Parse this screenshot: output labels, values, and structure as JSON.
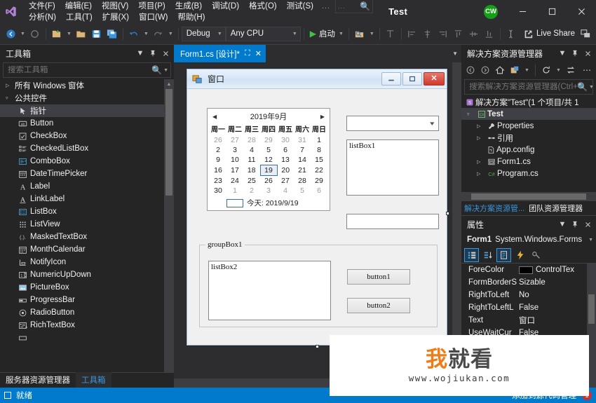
{
  "titlebar": {
    "logo_icon": "visual-studio-logo",
    "menus_row1": [
      "文件(F)",
      "编辑(E)",
      "视图(V)",
      "项目(P)",
      "生成(B)",
      "调试(D)",
      "格式(O)",
      "测试(S)"
    ],
    "menus_row2": [
      "分析(N)",
      "工具(T)",
      "扩展(X)",
      "窗口(W)",
      "帮助(H)"
    ],
    "menu_overflow": "...",
    "search_dots": "...",
    "app_title": "Test",
    "avatar_initials": "CW",
    "avatar_color": "#16a016",
    "minimize_icon": "minimize-icon",
    "maximize_icon": "maximize-icon",
    "close_icon": "close-icon"
  },
  "toolbar": {
    "back_icon": "navigate-back-icon",
    "forward_icon": "navigate-forward-icon",
    "new_project_icon": "new-project-icon",
    "open_icon": "open-file-icon",
    "save_icon": "save-icon",
    "save_all_icon": "save-all-icon",
    "undo_icon": "undo-icon",
    "redo_icon": "redo-icon",
    "config_value": "Debug",
    "platform_value": "Any CPU",
    "start_label": "启动",
    "start_icon": "play-icon",
    "find_icon": "find-in-files-icon",
    "align_icons": [
      "align-to-grid-icon",
      "align-lefts-icon",
      "align-centers-icon",
      "align-rights-icon",
      "align-tops-icon",
      "align-middles-icon",
      "align-bottoms-icon",
      "spacing-icon"
    ],
    "live_share_label": "Live Share",
    "live_share_icon": "live-share-icon",
    "feedback_icon": "feedback-icon"
  },
  "toolbox": {
    "title": "工具箱",
    "dropdown_icon": "chevron-down-icon",
    "pin_icon": "pin-icon",
    "close_icon": "close-icon",
    "search_placeholder": "搜索工具箱",
    "search_icon": "search-icon",
    "groups": [
      {
        "label": "所有 Windows 窗体",
        "expanded": false
      },
      {
        "label": "公共控件",
        "expanded": true
      }
    ],
    "items": [
      {
        "label": "指针",
        "icon": "pointer-icon",
        "selected": true
      },
      {
        "label": "Button",
        "icon": "button-icon"
      },
      {
        "label": "CheckBox",
        "icon": "checkbox-icon"
      },
      {
        "label": "CheckedListBox",
        "icon": "checked-listbox-icon"
      },
      {
        "label": "ComboBox",
        "icon": "combobox-icon"
      },
      {
        "label": "DateTimePicker",
        "icon": "datetimepicker-icon"
      },
      {
        "label": "Label",
        "icon": "label-icon"
      },
      {
        "label": "LinkLabel",
        "icon": "linklabel-icon"
      },
      {
        "label": "ListBox",
        "icon": "listbox-icon"
      },
      {
        "label": "ListView",
        "icon": "listview-icon"
      },
      {
        "label": "MaskedTextBox",
        "icon": "maskedtextbox-icon"
      },
      {
        "label": "MonthCalendar",
        "icon": "monthcalendar-icon"
      },
      {
        "label": "NotifyIcon",
        "icon": "notifyicon-icon"
      },
      {
        "label": "NumericUpDown",
        "icon": "numericupdown-icon"
      },
      {
        "label": "PictureBox",
        "icon": "picturebox-icon"
      },
      {
        "label": "ProgressBar",
        "icon": "progressbar-icon"
      },
      {
        "label": "RadioButton",
        "icon": "radiobutton-icon"
      },
      {
        "label": "RichTextBox",
        "icon": "richtextbox-icon"
      }
    ],
    "bottom_tabs": [
      {
        "label": "服务器资源管理器",
        "active": false
      },
      {
        "label": "工具箱",
        "active": true
      }
    ]
  },
  "designer": {
    "tab_label": "Form1.cs [设计]*",
    "tab_pin_icon": "pin-icon",
    "tab_close_icon": "close-icon",
    "form": {
      "title": "窗口",
      "icon": "form-icon",
      "minimize_icon": "minimize-icon",
      "maximize_icon": "maximize-icon",
      "close_icon": "close-icon",
      "calendar": {
        "prev_icon": "prev-arrow-icon",
        "next_icon": "next-arrow-icon",
        "month_title": "2019年9月",
        "weekdays": [
          "周一",
          "周二",
          "周三",
          "周四",
          "周五",
          "周六",
          "周日"
        ],
        "weeks": [
          [
            {
              "d": "26",
              "dim": true
            },
            {
              "d": "27",
              "dim": true
            },
            {
              "d": "28",
              "dim": true
            },
            {
              "d": "29",
              "dim": true
            },
            {
              "d": "30",
              "dim": true
            },
            {
              "d": "31",
              "dim": true
            },
            {
              "d": "1"
            }
          ],
          [
            {
              "d": "2"
            },
            {
              "d": "3"
            },
            {
              "d": "4"
            },
            {
              "d": "5"
            },
            {
              "d": "6"
            },
            {
              "d": "7"
            },
            {
              "d": "8"
            }
          ],
          [
            {
              "d": "9"
            },
            {
              "d": "10"
            },
            {
              "d": "11"
            },
            {
              "d": "12"
            },
            {
              "d": "13"
            },
            {
              "d": "14"
            },
            {
              "d": "15"
            }
          ],
          [
            {
              "d": "16"
            },
            {
              "d": "17"
            },
            {
              "d": "18"
            },
            {
              "d": "19",
              "today": true
            },
            {
              "d": "20"
            },
            {
              "d": "21"
            },
            {
              "d": "22"
            }
          ],
          [
            {
              "d": "23"
            },
            {
              "d": "24"
            },
            {
              "d": "25"
            },
            {
              "d": "26"
            },
            {
              "d": "27"
            },
            {
              "d": "28"
            },
            {
              "d": "29"
            }
          ],
          [
            {
              "d": "30"
            },
            {
              "d": "1",
              "dim": true
            },
            {
              "d": "2",
              "dim": true
            },
            {
              "d": "3",
              "dim": true
            },
            {
              "d": "4",
              "dim": true
            },
            {
              "d": "5",
              "dim": true
            },
            {
              "d": "6",
              "dim": true
            }
          ]
        ],
        "today_label": "今天: 2019/9/19"
      },
      "combobox_value": "",
      "combobox_icon": "chevron-down-icon",
      "listbox1_text": "listBox1",
      "textbox1_value": "",
      "groupbox_label": "groupBox1",
      "listbox2_text": "listBox2",
      "button1_label": "button1",
      "button2_label": "button2"
    }
  },
  "solution_explorer": {
    "title": "解决方案资源管理器",
    "dropdown_icon": "chevron-down-icon",
    "pin_icon": "pin-icon",
    "close_icon": "close-icon",
    "toolbar_icons": [
      "back-icon",
      "forward-icon",
      "home-icon",
      "pending-changes-icon",
      "refresh-icon",
      "sync-icon"
    ],
    "search_placeholder": "搜索解决方案资源管理器(Ctrl+",
    "search_icon": "search-icon",
    "tree": [
      {
        "label": "解决方案\"Test\"(1 个项目/共 1",
        "icon": "solution-icon",
        "indent": 0,
        "twisty": ""
      },
      {
        "label": "Test",
        "icon": "csharp-project-icon",
        "indent": 1,
        "twisty": "▲",
        "bold": true,
        "selected": true
      },
      {
        "label": "Properties",
        "icon": "properties-icon",
        "indent": 2,
        "twisty": "▷"
      },
      {
        "label": "引用",
        "icon": "references-icon",
        "indent": 2,
        "twisty": "▷"
      },
      {
        "label": "App.config",
        "icon": "config-file-icon",
        "indent": 3,
        "twisty": ""
      },
      {
        "label": "Form1.cs",
        "icon": "form-file-icon",
        "indent": 2,
        "twisty": "▷"
      },
      {
        "label": "Program.cs",
        "icon": "csharp-file-icon",
        "indent": 2,
        "twisty": "▷"
      }
    ],
    "tabs": [
      {
        "label": "解决方案资源管...",
        "active": true
      },
      {
        "label": "团队资源管理器",
        "active": false
      }
    ]
  },
  "properties": {
    "title": "属性",
    "dropdown_icon": "chevron-down-icon",
    "pin_icon": "pin-icon",
    "close_icon": "close-icon",
    "object_name": "Form1",
    "object_type": "System.Windows.Forms",
    "object_caret_icon": "chevron-down-icon",
    "toolbar_icons": [
      "categorized-icon",
      "alphabetical-icon",
      "properties-page-icon",
      "events-icon",
      "property-pages-icon"
    ],
    "rows": [
      {
        "name": "ForeColor",
        "value": "ControlTex",
        "swatch": "#000000"
      },
      {
        "name": "FormBorderS",
        "value": "Sizable"
      },
      {
        "name": "RightToLeft",
        "value": "No"
      },
      {
        "name": "RightToLeftL",
        "value": "False"
      },
      {
        "name": "Text",
        "value": "窗口"
      },
      {
        "name": "UseWaitCur",
        "value": "False"
      }
    ]
  },
  "status_bar": {
    "ready_label": "就绪",
    "ready_icon": "ready-icon",
    "right_text": "添加到源代码管理",
    "badge_count": "1"
  },
  "watermark": {
    "brand_orange": "我",
    "brand_gray": "就看",
    "url": "www.wojiukan.com",
    "orange_hex": "#f07c17"
  }
}
